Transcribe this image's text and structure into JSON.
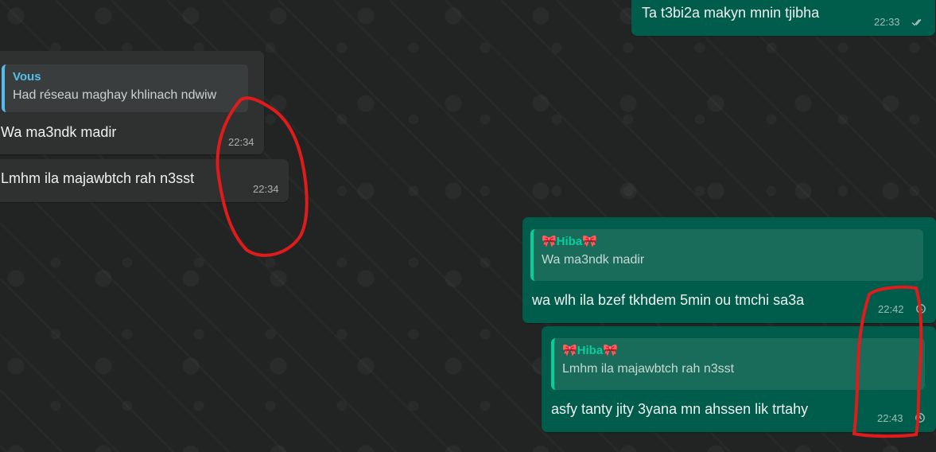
{
  "chat": {
    "messages": [
      {
        "text": "Ta t3bi2a makyn mnin tjibha",
        "time": "22:33",
        "status_icon": "double-check-icon"
      },
      {
        "reply_author": "Vous",
        "reply_text": "Had réseau maghay khlinach ndwiw",
        "text": "Wa ma3ndk madir",
        "time": "22:34"
      },
      {
        "text": "Lmhm ila majawbtch rah n3sst",
        "time": "22:34"
      },
      {
        "reply_author": "🎀Hiba🎀",
        "reply_text": "Wa ma3ndk madir",
        "text": "wa wlh ila bzef tkhdem 5min ou tmchi sa3a",
        "time": "22:42",
        "status_icon": "clock-pending-icon"
      },
      {
        "reply_author": "🎀Hiba🎀",
        "reply_text": "Lmhm ila majawbtch rah n3sst",
        "text": "asfy tanty jity 3yana mn ahssen lik trtahy",
        "time": "22:43",
        "status_icon": "clock-pending-icon"
      }
    ]
  },
  "colors": {
    "background": "#222424",
    "incoming_bubble": "#2e3130",
    "outgoing_bubble": "#005c4b",
    "incoming_quote_accent": "#53bdeb",
    "outgoing_quote_accent": "#06cf9c",
    "annotation": "#e01b1b"
  }
}
